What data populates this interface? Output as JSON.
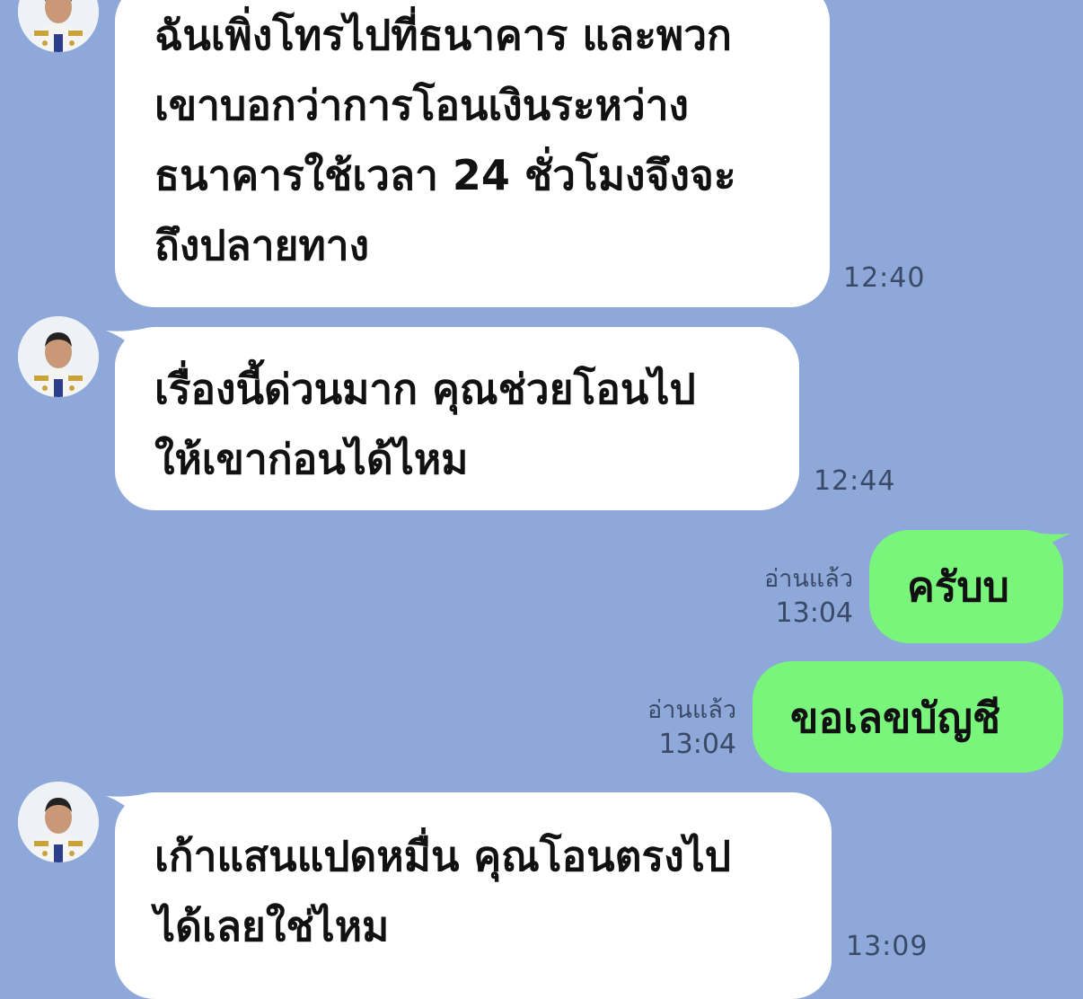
{
  "messages": [
    {
      "id": "m1",
      "side": "in",
      "lines": [
        "ฉันเพิ่งโทรไปที่ธนาคาร และพวก",
        "เขาบอกว่าการโอนเงินระหว่าง",
        "ธนาคารใช้เวลา 24 ชั่วโมงจึงจะ",
        "ถึงปลายทาง"
      ],
      "time": "12:40"
    },
    {
      "id": "m2",
      "side": "in",
      "lines": [
        " เรื่องนี้ด่วนมาก คุณช่วยโอนไป",
        "ให้เขาก่อนได้ไหม"
      ],
      "time": "12:44"
    },
    {
      "id": "m3",
      "side": "out",
      "lines": [
        "ครับบ"
      ],
      "read": "อ่านแล้ว",
      "time": "13:04"
    },
    {
      "id": "m4",
      "side": "out",
      "lines": [
        "ขอเลขบัญชี"
      ],
      "read": "อ่านแล้ว",
      "time": "13:04"
    },
    {
      "id": "m5",
      "side": "in",
      "lines": [
        "เก้าแสนแปดหมื่น คุณโอนตรงไป",
        "ได้เลยใช่ไหม"
      ],
      "time": "13:09"
    }
  ],
  "colors": {
    "background": "#8da8d9",
    "incoming_bubble": "#ffffff",
    "outgoing_bubble": "#7af57c"
  },
  "icons": {
    "avatar": "contact-avatar"
  }
}
